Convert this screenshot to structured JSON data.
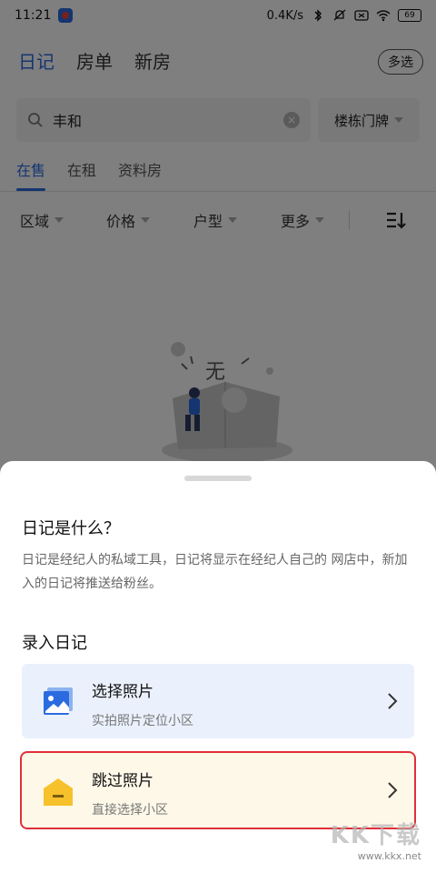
{
  "status_bar": {
    "time": "11:21",
    "net_speed": "0.4K/s",
    "battery": "69"
  },
  "top_tabs": [
    {
      "label": "日记",
      "active": true
    },
    {
      "label": "房单",
      "active": false
    },
    {
      "label": "新房",
      "active": false
    }
  ],
  "multi_select_label": "多选",
  "search": {
    "value": "丰和",
    "building_select": "楼栋门牌"
  },
  "sub_tabs": [
    {
      "label": "在售",
      "active": true
    },
    {
      "label": "在租",
      "active": false
    },
    {
      "label": "资料房",
      "active": false
    }
  ],
  "filters": [
    "区域",
    "价格",
    "户型",
    "更多"
  ],
  "empty_state": {
    "glyph": "无"
  },
  "sheet": {
    "title": "日记是什么？",
    "description": "日记是经纪人的私域工具，日记将显示在经纪人自己的 网店中，新加入的日记将推送给粉丝。",
    "section_title": "录入日记",
    "options": [
      {
        "title": "选择照片",
        "subtitle": "实拍照片定位小区",
        "icon": "image-icon",
        "color": "#2a6be0"
      },
      {
        "title": "跳过照片",
        "subtitle": "直接选择小区",
        "icon": "house-icon",
        "color": "#f6c12b"
      }
    ]
  },
  "watermark": {
    "text": "KK下载",
    "url": "www.kkx.net"
  },
  "colors": {
    "accent": "#2a6be0",
    "highlight_border": "#e0303a"
  }
}
